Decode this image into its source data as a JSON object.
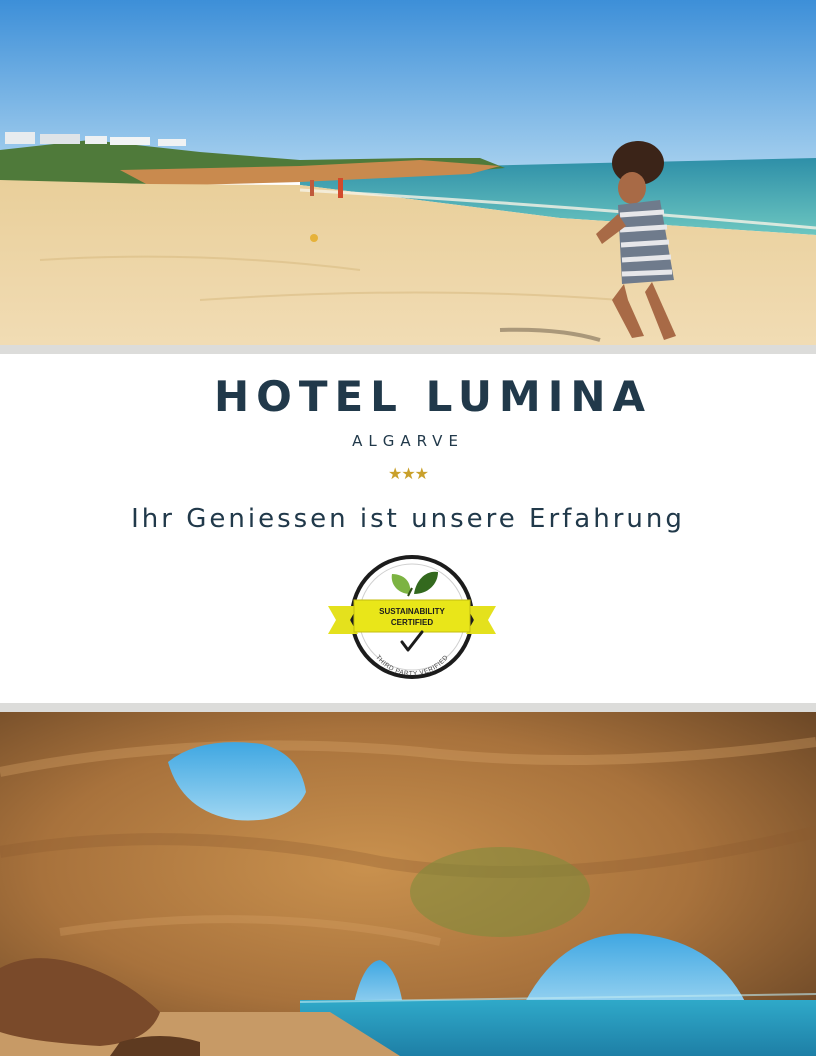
{
  "document": {
    "title": "HOTEL LUMINA",
    "subtitle": "ALGARVE",
    "stars": "★★★",
    "star_rating": 3,
    "tagline": "Ihr Geniessen ist unsere Erfahrung",
    "badge": {
      "line1": "SUSTAINABILITY",
      "line2": "CERTIFIED",
      "arc_text": "THIRD PARTY VERIFIED"
    },
    "images": {
      "top": "beach-photo",
      "bottom": "sea-cave-photo"
    },
    "colors": {
      "text": "#21394a",
      "stars": "#c9a02b",
      "badge_ribbon": "#e4e11d",
      "divider": "#dcdcda"
    }
  }
}
